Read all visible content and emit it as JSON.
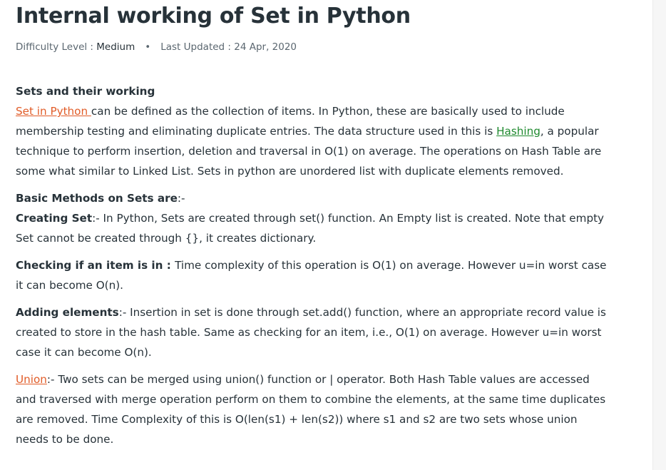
{
  "article": {
    "title": "Internal working of Set in Python",
    "meta": {
      "difficulty_label": "Difficulty Level : ",
      "difficulty_value": "Medium",
      "bullet": "•",
      "updated_label": "Last Updated : ",
      "updated_value": "24 Apr, 2020"
    },
    "sections": {
      "heading": "Sets and their working",
      "intro": {
        "link_text": "Set in Python ",
        "text1": "can be defined as the collection of items. In Python, these are basically used to include membership testing and eliminating duplicate entries. The data structure used in this is ",
        "hashing_link": "Hashing",
        "text2": ", a popular technique to perform insertion, deletion and traversal in O(1) on average. The operations on Hash Table are some what similar to Linked List. Sets in python are unordered list with duplicate elements removed."
      },
      "basic_methods": {
        "label": "Basic Methods on Sets are",
        "suffix": ":-"
      },
      "creating_set": {
        "label": "Creating Set",
        "text": ":- In Python, Sets are created through set() function. An Empty list is created. Note that empty Set cannot be created through {}, it creates dictionary."
      },
      "checking": {
        "label": "Checking if an item is in : ",
        "text": "Time complexity of this operation is O(1) on average. However u=in worst case it can become O(n)."
      },
      "adding": {
        "label": "Adding elements",
        "text": ":- Insertion in set is done through set.add() function, where an appropriate record value is created to store in the hash table. Same as checking for an item, i.e., O(1) on average. However u=in worst case it can become O(n)."
      },
      "union": {
        "link_text": "Union",
        "text": ":- Two sets can be merged using union() function or | operator. Both Hash Table values are accessed and traversed with merge operation perform on them to combine the elements, at the same time duplicates are removed. Time Complexity of this is O(len(s1) + len(s2)) where s1 and s2 are two sets whose union needs to be done."
      }
    }
  },
  "colors": {
    "text": "#273239",
    "muted": "#5b6770",
    "link_orange": "#e15c28",
    "link_green": "#1f8a2f"
  }
}
